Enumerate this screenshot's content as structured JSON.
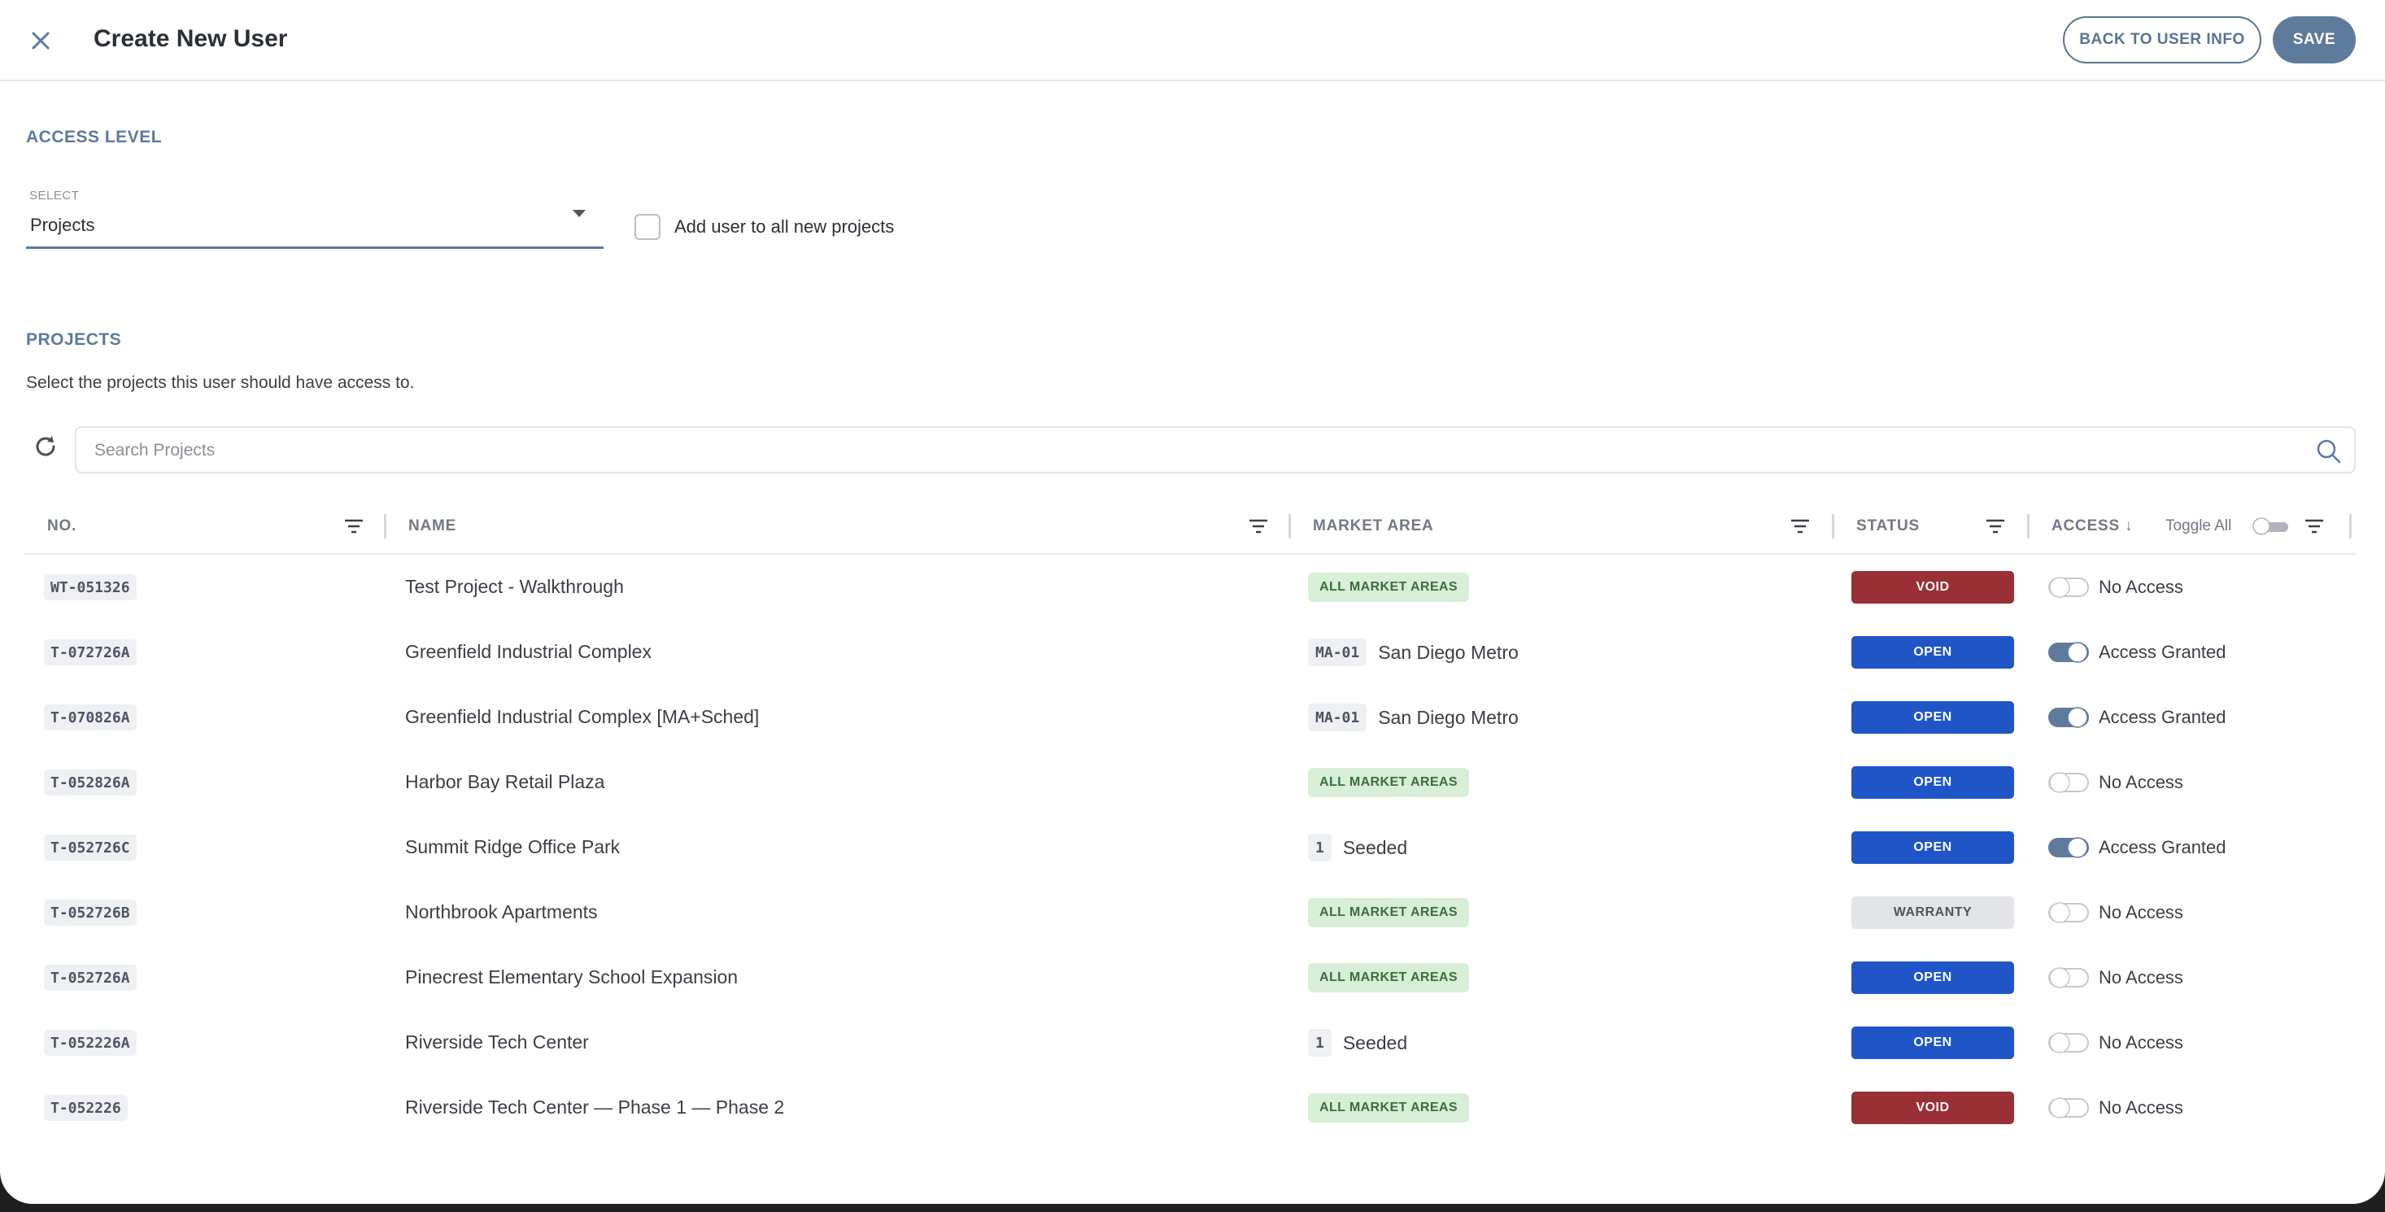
{
  "header": {
    "title": "Create New User",
    "back_label": "BACK TO USER INFO",
    "save_label": "SAVE"
  },
  "access_level": {
    "section_label": "ACCESS LEVEL",
    "select_small_label": "SELECT",
    "select_value": "Projects",
    "checkbox_label": "Add user to all new projects",
    "checkbox_checked": false
  },
  "projects": {
    "section_label": "PROJECTS",
    "description": "Select the projects this user should have access to.",
    "search_placeholder": "Search Projects"
  },
  "table": {
    "columns": {
      "no": "NO.",
      "name": "NAME",
      "market_area": "MARKET AREA",
      "status": "STATUS",
      "access": "ACCESS ↓",
      "toggle_all": "Toggle All"
    },
    "rows": [
      {
        "no": "WT-051326",
        "name": "Test Project - Walkthrough",
        "ma_type": "all",
        "ma_badge": "ALL MARKET AREAS",
        "ma_text": "",
        "status": "VOID",
        "access_on": false,
        "access_text": "No Access"
      },
      {
        "no": "T-072726A",
        "name": "Greenfield Industrial Complex",
        "ma_type": "code",
        "ma_badge": "MA-01",
        "ma_text": "San Diego Metro",
        "status": "OPEN",
        "access_on": true,
        "access_text": "Access Granted"
      },
      {
        "no": "T-070826A",
        "name": "Greenfield Industrial Complex [MA+Sched]",
        "ma_type": "code",
        "ma_badge": "MA-01",
        "ma_text": "San Diego Metro",
        "status": "OPEN",
        "access_on": true,
        "access_text": "Access Granted"
      },
      {
        "no": "T-052826A",
        "name": "Harbor Bay Retail Plaza",
        "ma_type": "all",
        "ma_badge": "ALL MARKET AREAS",
        "ma_text": "",
        "status": "OPEN",
        "access_on": false,
        "access_text": "No Access"
      },
      {
        "no": "T-052726C",
        "name": "Summit Ridge Office Park",
        "ma_type": "code",
        "ma_badge": "1",
        "ma_text": "Seeded",
        "status": "OPEN",
        "access_on": true,
        "access_text": "Access Granted"
      },
      {
        "no": "T-052726B",
        "name": "Northbrook Apartments",
        "ma_type": "all",
        "ma_badge": "ALL MARKET AREAS",
        "ma_text": "",
        "status": "WARRANTY",
        "access_on": false,
        "access_text": "No Access"
      },
      {
        "no": "T-052726A",
        "name": "Pinecrest Elementary School Expansion",
        "ma_type": "all",
        "ma_badge": "ALL MARKET AREAS",
        "ma_text": "",
        "status": "OPEN",
        "access_on": false,
        "access_text": "No Access"
      },
      {
        "no": "T-052226A",
        "name": "Riverside Tech Center",
        "ma_type": "code",
        "ma_badge": "1",
        "ma_text": "Seeded",
        "status": "OPEN",
        "access_on": false,
        "access_text": "No Access"
      },
      {
        "no": "T-052226",
        "name": "Riverside Tech Center — Phase 1 — Phase 2",
        "ma_type": "all",
        "ma_badge": "ALL MARKET AREAS",
        "ma_text": "",
        "status": "VOID",
        "access_on": false,
        "access_text": "No Access"
      }
    ]
  },
  "icons": {
    "close": "close-icon",
    "refresh": "refresh-icon",
    "search": "search-icon",
    "filter": "filter-icon",
    "dropdown": "chevron-down-icon"
  },
  "colors": {
    "accent": "#5a7aa0",
    "status_void": "#993035",
    "status_open": "#1f55c6",
    "status_warranty": "#e2e4e8",
    "market_all_bg": "#d8efd7",
    "toggle_on": "#5f7b9c"
  }
}
